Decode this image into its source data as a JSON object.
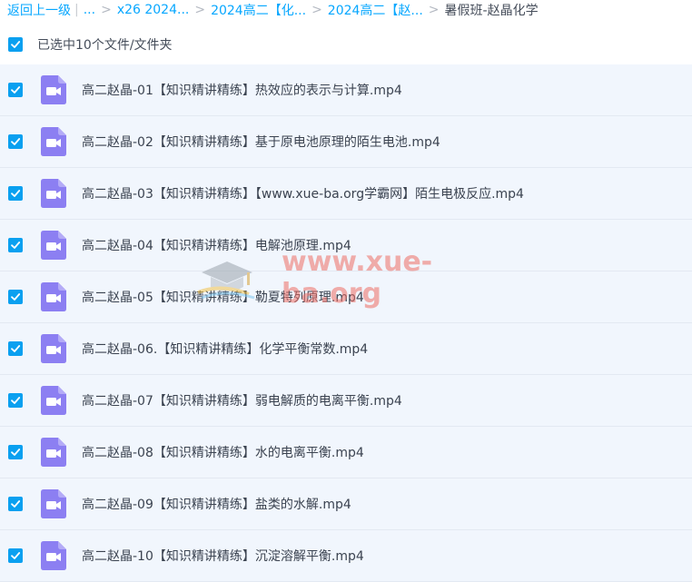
{
  "breadcrumb": {
    "back": "返回上一级",
    "ellipsis": "...",
    "items": [
      "x26 2024...",
      "2024高二【化...",
      "2024高二【赵..."
    ],
    "current": "暑假班-赵晶化学"
  },
  "selection": {
    "label": "已选中10个文件/文件夹"
  },
  "files": [
    {
      "name": "高二赵晶-01【知识精讲精练】热效应的表示与计算.mp4"
    },
    {
      "name": "高二赵晶-02【知识精讲精练】基于原电池原理的陌生电池.mp4"
    },
    {
      "name": "高二赵晶-03【知识精讲精练】【www.xue-ba.org学霸网】陌生电极反应.mp4"
    },
    {
      "name": "高二赵晶-04【知识精讲精练】电解池原理.mp4"
    },
    {
      "name": "高二赵晶-05【知识精讲精练】勒夏特列原理.mp4"
    },
    {
      "name": "高二赵晶-06.【知识精讲精练】化学平衡常数.mp4"
    },
    {
      "name": "高二赵晶-07【知识精讲精练】弱电解质的电离平衡.mp4"
    },
    {
      "name": "高二赵晶-08【知识精讲精练】水的电离平衡.mp4"
    },
    {
      "name": "高二赵晶-09【知识精讲精练】盐类的水解.mp4"
    },
    {
      "name": "高二赵晶-10【知识精讲精练】沉淀溶解平衡.mp4"
    }
  ],
  "watermark": {
    "text": "www.xue-ba.org"
  },
  "colors": {
    "accent": "#06a7ff",
    "checkbox": "#0aa0f0",
    "video_icon": "#8c7ff2",
    "row_bg": "#f1f6fd"
  },
  "icons": {
    "checkbox": "check-icon",
    "file": "video-file-icon"
  }
}
